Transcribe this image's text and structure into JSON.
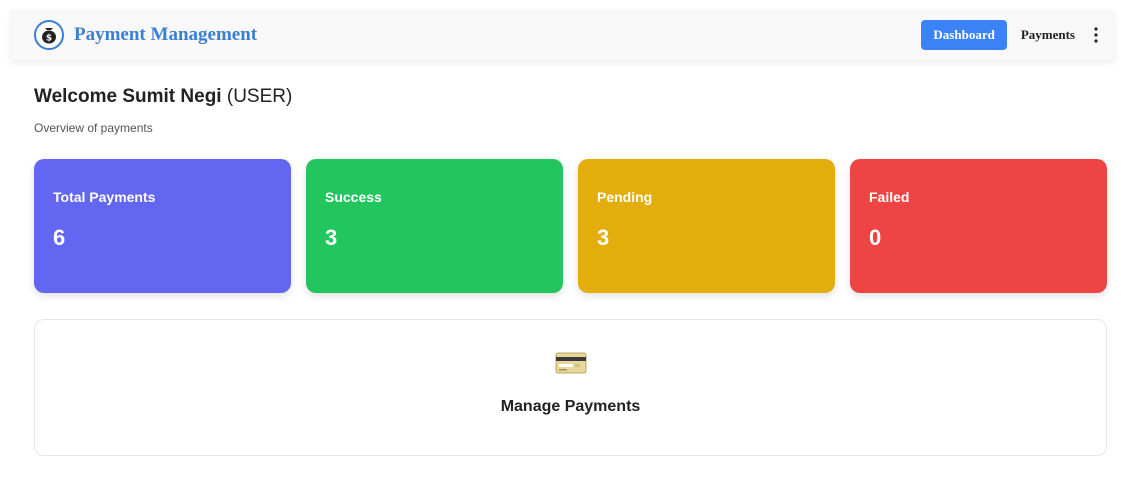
{
  "brand": {
    "title": "Payment Management",
    "logo_icon": "money-bag-icon",
    "color": "#3b7fd4"
  },
  "nav": {
    "dashboard_label": "Dashboard",
    "payments_label": "Payments",
    "menu_icon": "kebab-menu-icon",
    "active_color": "#3b82f6"
  },
  "welcome": {
    "prefix": "Welcome",
    "name": "Sumit Negi",
    "role": "(USER)"
  },
  "subtitle": "Overview of payments",
  "stats": [
    {
      "label": "Total Payments",
      "value": "6",
      "color": "#6366f1"
    },
    {
      "label": "Success",
      "value": "3",
      "color": "#22c55e"
    },
    {
      "label": "Pending",
      "value": "3",
      "color": "#e3ae0b"
    },
    {
      "label": "Failed",
      "value": "0",
      "color": "#ef4444"
    }
  ],
  "manage": {
    "icon": "credit-card-icon",
    "label": "Manage Payments"
  }
}
